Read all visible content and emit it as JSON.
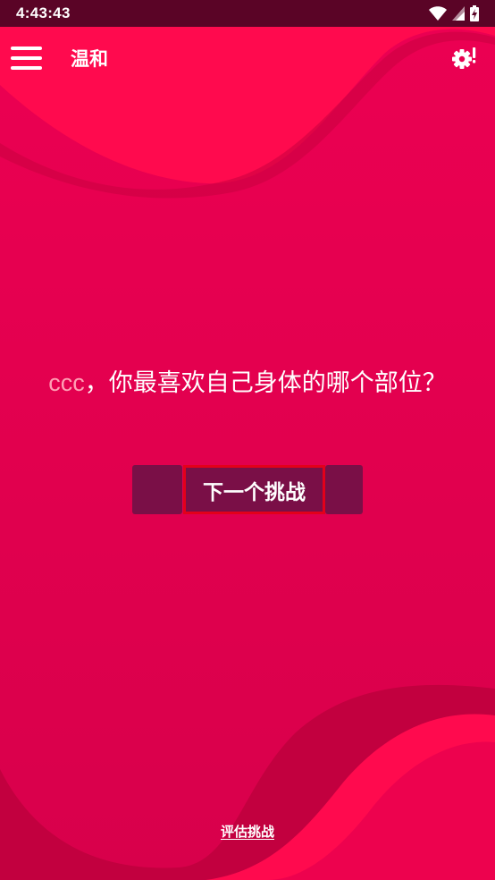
{
  "status_bar": {
    "time": "4:43:43",
    "icons": [
      "wifi-icon",
      "cellular-signal-icon",
      "battery-charging-icon"
    ]
  },
  "app_bar": {
    "title": "温和",
    "menu_icon": "hamburger-menu-icon",
    "settings_icon": "settings-alert-icon"
  },
  "challenge": {
    "player_name": "ccc",
    "question_text": "，你最喜欢自己身体的哪个部位？"
  },
  "buttons": {
    "next_label": "下一个挑战"
  },
  "footer": {
    "rate_label": "评估挑战"
  },
  "colors": {
    "background": "#e0004e",
    "wave_bright": "#ff0a4e",
    "wave_dark": "#c2003f",
    "status_bar": "#5a0426",
    "button": "#7a0f47",
    "button_border": "#e3001b",
    "name_highlight": "#ff9fb4"
  }
}
